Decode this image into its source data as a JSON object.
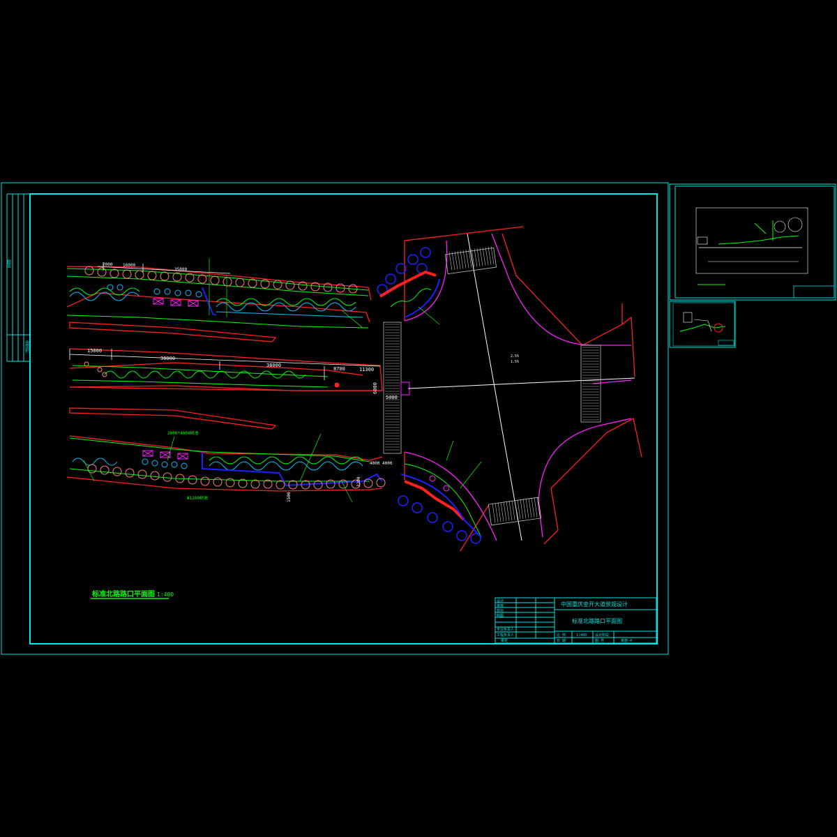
{
  "drawing": {
    "title_label": "标准北路路口平面图",
    "title_scale": "1:400",
    "dimensions": {
      "top_1": "2000",
      "top_2": "16000",
      "top_3": "35000",
      "mid_1": "15000",
      "mid_2": "38000",
      "mid_3": "38000",
      "mid_4": "8700",
      "mid_5": "11300",
      "mid_6": "5000",
      "mid_7": "6000",
      "bottom_1": "2000*4000树池",
      "bottom_2": "4000 4000",
      "bottom_3": "Φ1200树池",
      "bottom_4": "1500",
      "bottom_5": "3200",
      "axis_1": "2.5%",
      "axis_2": "1.5%"
    }
  },
  "title_block": {
    "company": "中国重庆金开大道景观设计",
    "drawing_name": "标准北路路口平面图",
    "rows_left": [
      "设计",
      "审核",
      "校对",
      "制图",
      "专业负责人",
      "工程负责人",
      "审定"
    ],
    "scale_label": "比 例",
    "scale_value": "1:400",
    "date_label": "日 期",
    "number_label": "图 号",
    "number_value": "景施-4",
    "stage_label": "设计阶段"
  },
  "left_strip": {
    "label_a": "图签",
    "label_b": "会签栏"
  },
  "colors": {
    "frame": "#00e5e5",
    "road": "#ff2020",
    "planting": "#00ff00",
    "water": "#00c0ff",
    "tree": "#ff8080",
    "pavement": "#ff20ff",
    "crosswalk": "#c0c0c0",
    "blue": "#2020ff",
    "white": "#ffffff"
  }
}
